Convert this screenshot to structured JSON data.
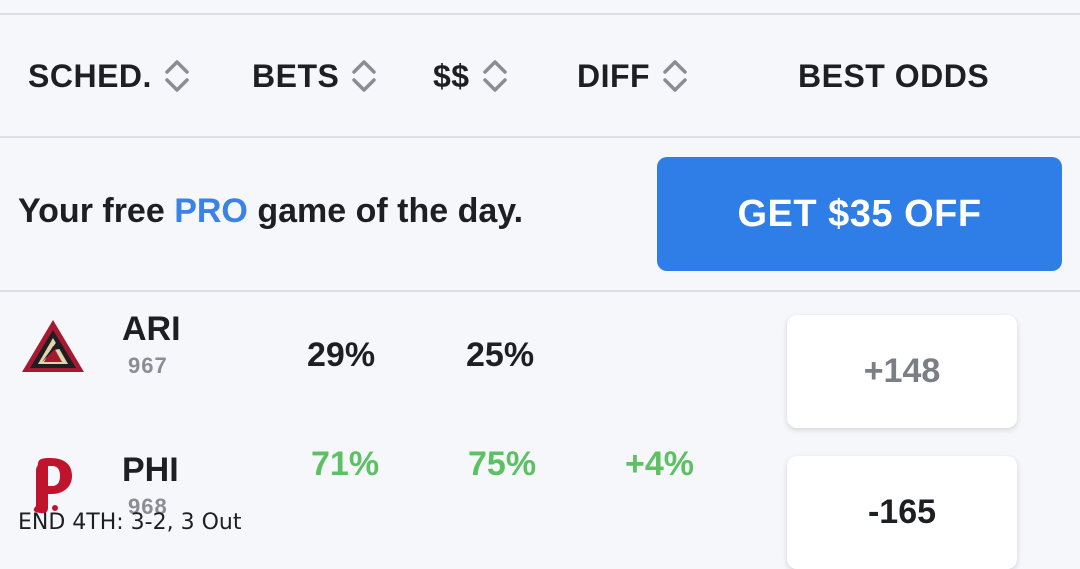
{
  "header": {
    "columns": [
      {
        "label": "SCHED.",
        "sortable": true
      },
      {
        "label": "BETS",
        "sortable": true
      },
      {
        "label": "$$",
        "sortable": true
      },
      {
        "label": "DIFF",
        "sortable": true
      },
      {
        "label": "BEST ODDS",
        "sortable": false
      }
    ]
  },
  "promo": {
    "text_before": "Your free ",
    "text_pro": "PRO",
    "text_after": " game of the day.",
    "button_label": "GET $35 OFF",
    "button_color": "#2f7ee8",
    "pro_color": "#3a82e6"
  },
  "games": [
    {
      "abbr": "ARI",
      "number": "967",
      "logo": "diamondbacks-logo",
      "bets": "29%",
      "money": "25%",
      "diff": "",
      "odds": "+148",
      "highlight": false
    },
    {
      "abbr": "PHI",
      "number": "968",
      "logo": "phillies-logo",
      "bets": "71%",
      "money": "75%",
      "diff": "+4%",
      "odds": "-165",
      "highlight": true
    }
  ],
  "status": "END 4TH: 3-2, 3 Out",
  "colors": {
    "green": "#5ec064",
    "divider": "#dcdfe4",
    "background": "#f6f7fb"
  }
}
